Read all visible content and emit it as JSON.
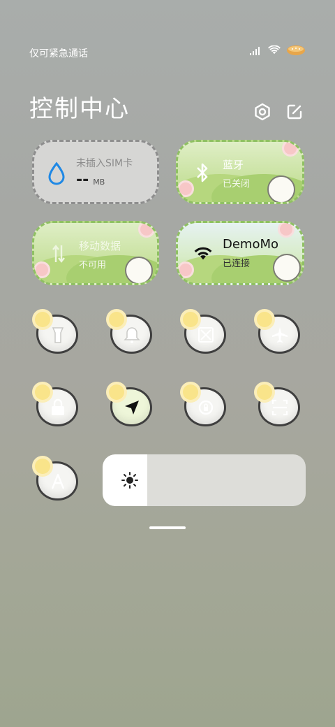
{
  "status_bar": {
    "carrier_text": "仅可紧急通话",
    "icons": [
      "signal-icon",
      "wifi-icon",
      "battery-icon"
    ]
  },
  "header": {
    "title": "控制中心",
    "settings_icon": "gear-icon",
    "edit_icon": "edit-icon"
  },
  "tiles": {
    "data": {
      "label": "未插入SIM卡",
      "value": "--",
      "unit": "MB",
      "icon": "water-drop-icon"
    },
    "bluetooth": {
      "label": "蓝牙",
      "status": "已关闭",
      "icon": "bluetooth-icon"
    },
    "mobile": {
      "label": "移动数据",
      "status": "不可用",
      "icon": "mobile-data-icon"
    },
    "wifi": {
      "label": "DemoMo",
      "status": "已连接",
      "icon": "wifi-icon"
    }
  },
  "quick_toggles": [
    {
      "name": "flashlight",
      "icon": "flashlight-icon",
      "active": false
    },
    {
      "name": "ringtone",
      "icon": "bell-icon",
      "active": false
    },
    {
      "name": "screenshot",
      "icon": "scissors-icon",
      "active": false
    },
    {
      "name": "airplane",
      "icon": "airplane-icon",
      "active": false
    },
    {
      "name": "lock-screen",
      "icon": "lock-icon",
      "active": false
    },
    {
      "name": "location",
      "icon": "location-arrow-icon",
      "active": true
    },
    {
      "name": "rotation-lock",
      "icon": "rotation-lock-icon",
      "active": false
    },
    {
      "name": "scan",
      "icon": "scan-icon",
      "active": false
    },
    {
      "name": "auto-brightness",
      "icon": "auto-brightness-icon",
      "active": false
    }
  ],
  "brightness": {
    "level": 0.22,
    "icon": "sun-icon"
  },
  "colors": {
    "accent": "#1e88e5",
    "tile_green": "#c9e2a0"
  }
}
